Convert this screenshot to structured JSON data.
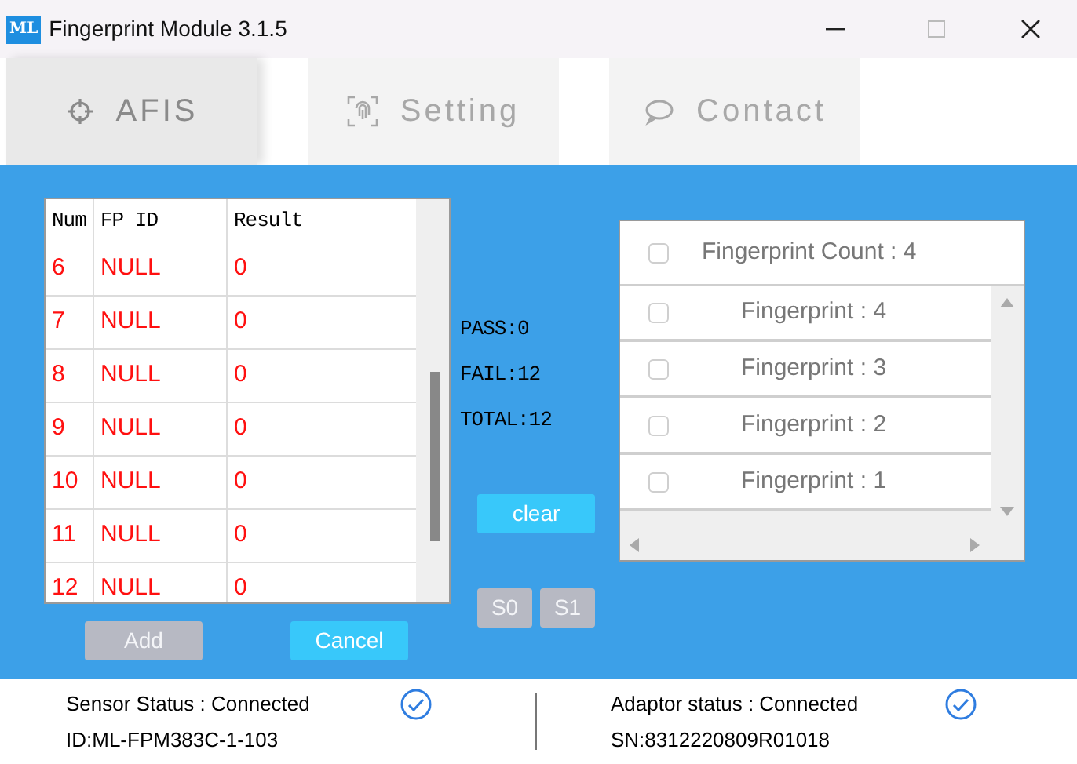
{
  "window": {
    "logo": "ML",
    "title": "Fingerprint Module 3.1.5"
  },
  "tabs": [
    {
      "label": "AFIS",
      "selected": true
    },
    {
      "label": "Setting",
      "selected": false
    },
    {
      "label": "Contact",
      "selected": false
    }
  ],
  "table": {
    "columns": [
      "Num",
      "FP ID",
      "Result"
    ],
    "rows": [
      [
        "6",
        "NULL",
        "0"
      ],
      [
        "7",
        "NULL",
        "0"
      ],
      [
        "8",
        "NULL",
        "0"
      ],
      [
        "9",
        "NULL",
        "0"
      ],
      [
        "10",
        "NULL",
        "0"
      ],
      [
        "11",
        "NULL",
        "0"
      ],
      [
        "12",
        "NULL",
        "0"
      ]
    ]
  },
  "stats": [
    "PASS:0",
    "FAIL:12",
    "TOTAL:12"
  ],
  "clear_button": {
    "label": "clear",
    "disabled": false
  },
  "slot_buttons": [
    {
      "label": "S0",
      "disabled": true
    },
    {
      "label": "S1",
      "disabled": true
    }
  ],
  "form_buttons": [
    {
      "label": "Add",
      "disabled": true
    },
    {
      "label": "Cancel",
      "disabled": false
    }
  ],
  "fingerprint_list": {
    "header": {
      "label": "Fingerprint Count : 4",
      "checked": false
    },
    "items": [
      {
        "label": "Fingerprint : 4",
        "checked": false
      },
      {
        "label": "Fingerprint : 3",
        "checked": false
      },
      {
        "label": "Fingerprint : 2",
        "checked": false
      },
      {
        "label": "Fingerprint : 1",
        "checked": false
      }
    ]
  },
  "status_bar": [
    {
      "status": "Sensor Status : Connected",
      "detail": "ID:ML-FPM383C-1-103",
      "connected": true
    },
    {
      "status": "Adaptor status : Connected",
      "detail": "SN:8312220809R01018",
      "connected": true
    }
  ]
}
